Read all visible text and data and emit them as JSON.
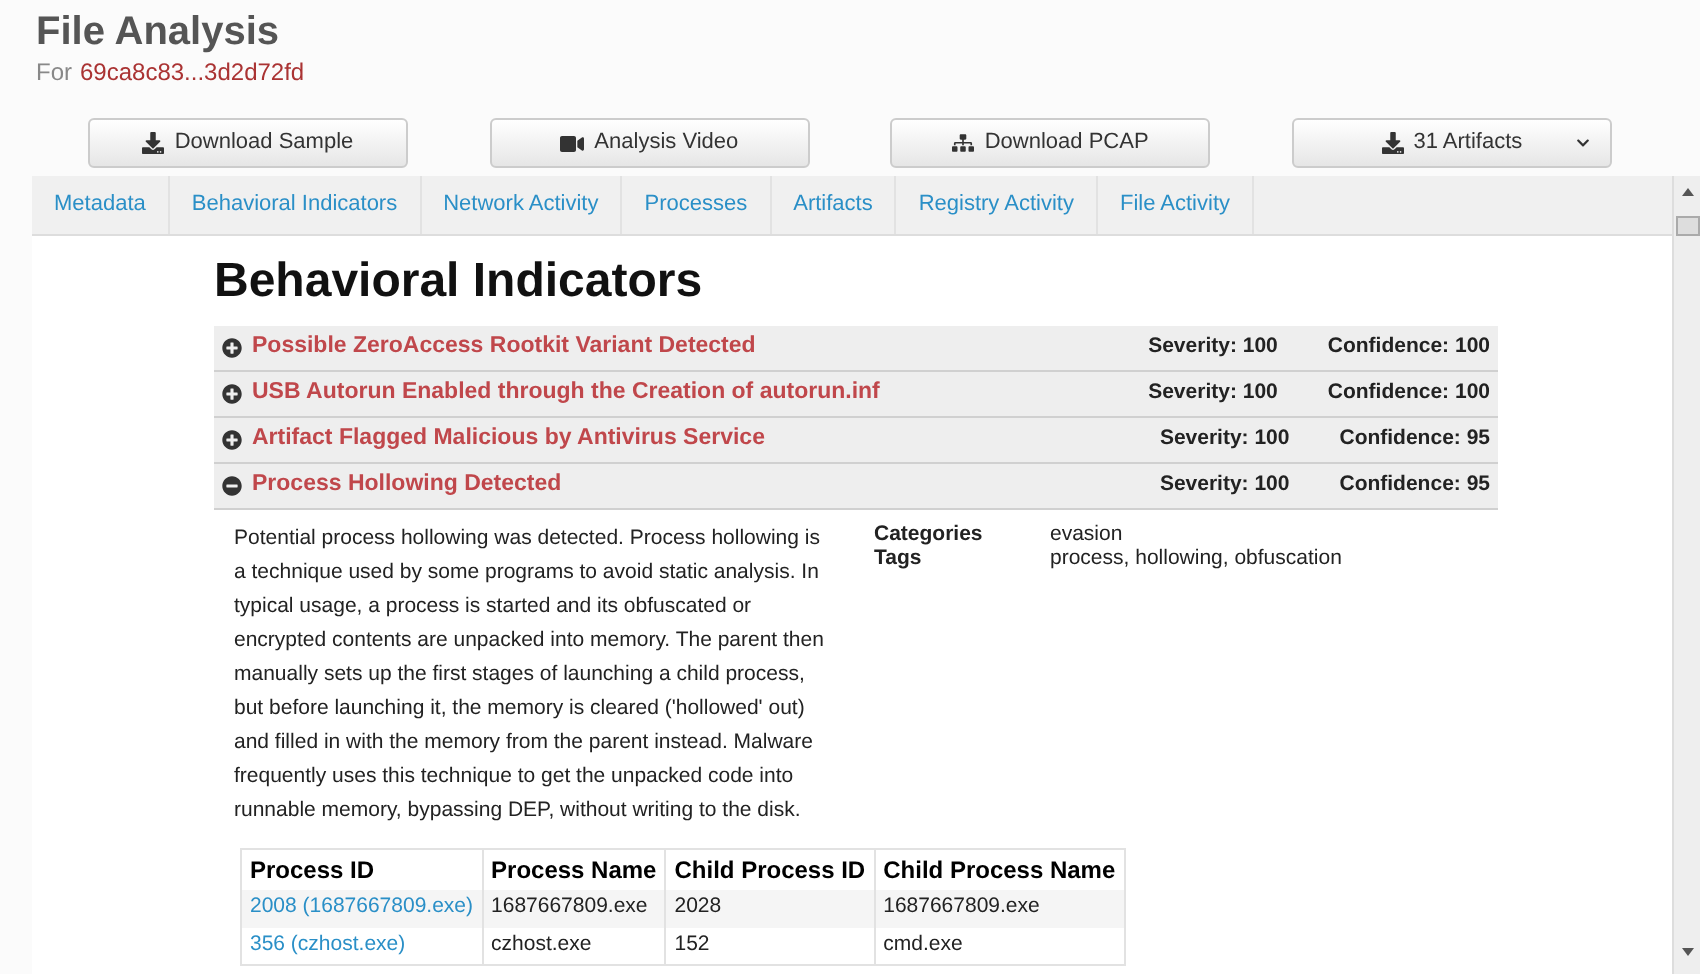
{
  "header": {
    "title": "File Analysis",
    "for_label": "For",
    "hash": "69ca8c83...3d2d72fd"
  },
  "actions": [
    {
      "kind": "download",
      "label": "Download Sample"
    },
    {
      "kind": "video",
      "label": "Analysis Video"
    },
    {
      "kind": "network",
      "label": "Download PCAP"
    },
    {
      "kind": "dropdown",
      "label": "31 Artifacts"
    }
  ],
  "tabs": [
    "Metadata",
    "Behavioral Indicators",
    "Network Activity",
    "Processes",
    "Artifacts",
    "Registry Activity",
    "File Activity"
  ],
  "section_title": "Behavioral Indicators",
  "indicators": [
    {
      "title": "Possible ZeroAccess Rootkit Variant Detected",
      "severity": "Severity: 100",
      "confidence": "Confidence: 100",
      "expanded": false
    },
    {
      "title": "USB Autorun Enabled through the Creation of autorun.inf",
      "severity": "Severity: 100",
      "confidence": "Confidence: 100",
      "expanded": false
    },
    {
      "title": "Artifact Flagged Malicious by Antivirus Service",
      "severity": "Severity: 100",
      "confidence": "Confidence: 95",
      "expanded": false
    },
    {
      "title": "Process Hollowing Detected",
      "severity": "Severity: 100",
      "confidence": "Confidence: 95",
      "expanded": true
    }
  ],
  "detail": {
    "description": "Potential process hollowing was detected. Process hollowing is a technique used by some programs to avoid static analysis. In typical usage, a process is started and its obfuscated or encrypted contents are unpacked into memory. The parent then manually sets up the first stages of launching a child process, but before launching it, the memory is cleared ('hollowed' out) and filled in with the memory from the parent instead. Malware frequently uses this technique to get the unpacked code into runnable memory, bypassing DEP, without writing to the disk.",
    "properties": [
      {
        "label": "Categories",
        "value": "evasion"
      },
      {
        "label": "Tags",
        "value": "process, hollowing, obfuscation"
      }
    ],
    "table": {
      "columns": [
        "Process ID",
        "Process Name",
        "Child Process ID",
        "Child Process Name"
      ],
      "rows": [
        [
          "2008 (1687667809.exe)",
          "1687667809.exe",
          "2028",
          "1687667809.exe"
        ],
        [
          "356 (czhost.exe)",
          "czhost.exe",
          "152",
          "cmd.exe"
        ]
      ]
    }
  }
}
